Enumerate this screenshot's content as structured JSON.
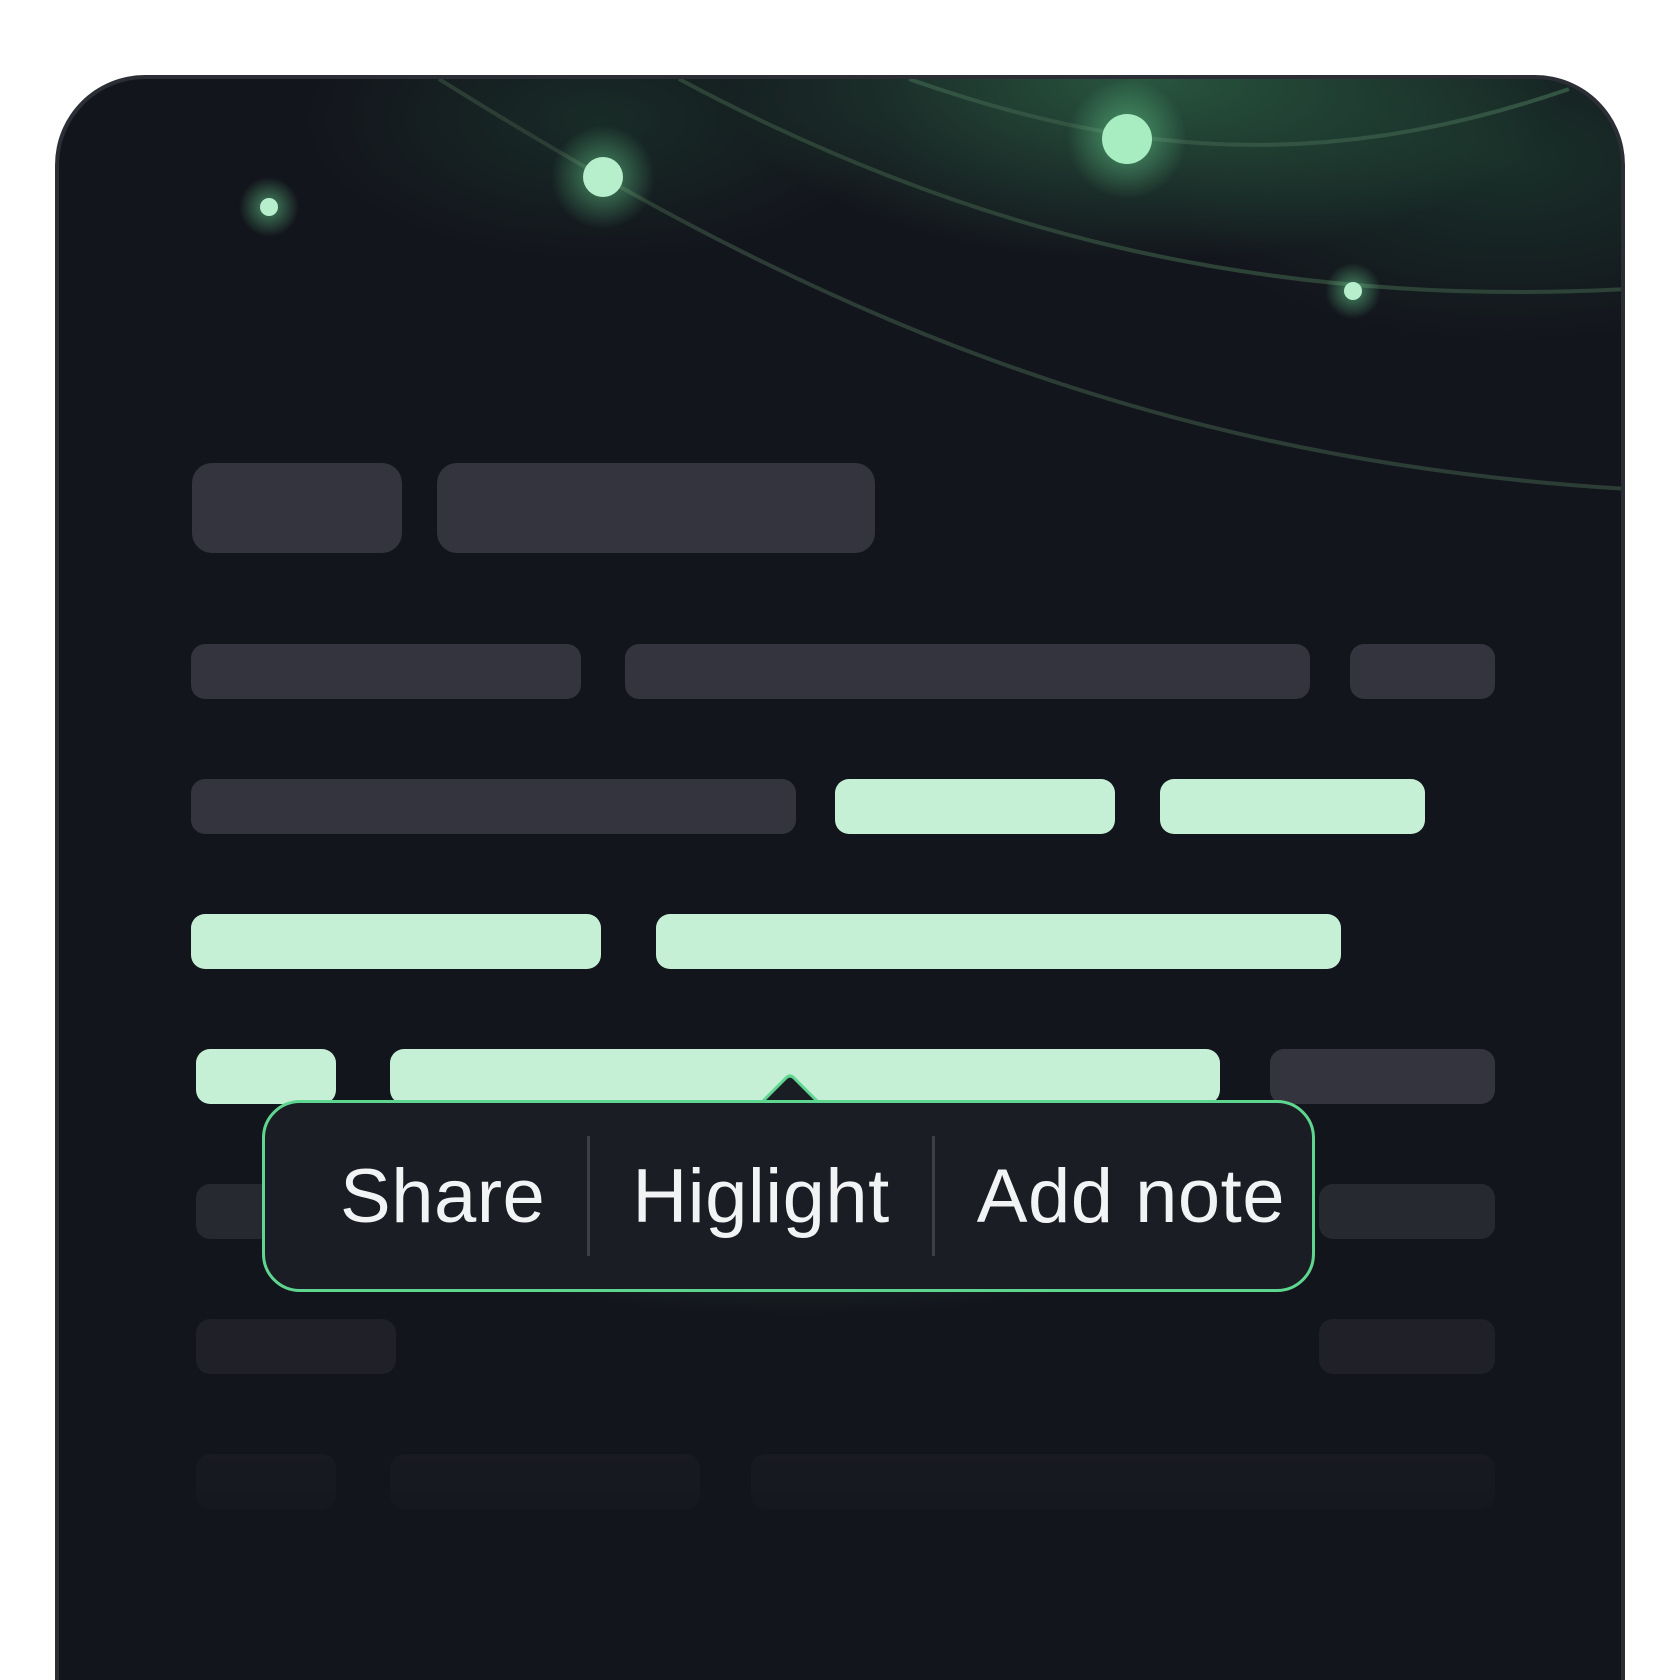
{
  "popover": {
    "items": [
      {
        "label": "Share"
      },
      {
        "label": "Higlight"
      },
      {
        "label": "Add note"
      }
    ]
  },
  "colors": {
    "background": "#13151c",
    "placeholder": "#33343e",
    "highlight": "#c6f0d6",
    "accent": "#5fd68f",
    "popover_bg": "#1b1d25",
    "text": "#f2f3f5"
  },
  "icons": {
    "caret": "caret-up-icon",
    "orbit_dots": "glowing-dot-icon"
  }
}
